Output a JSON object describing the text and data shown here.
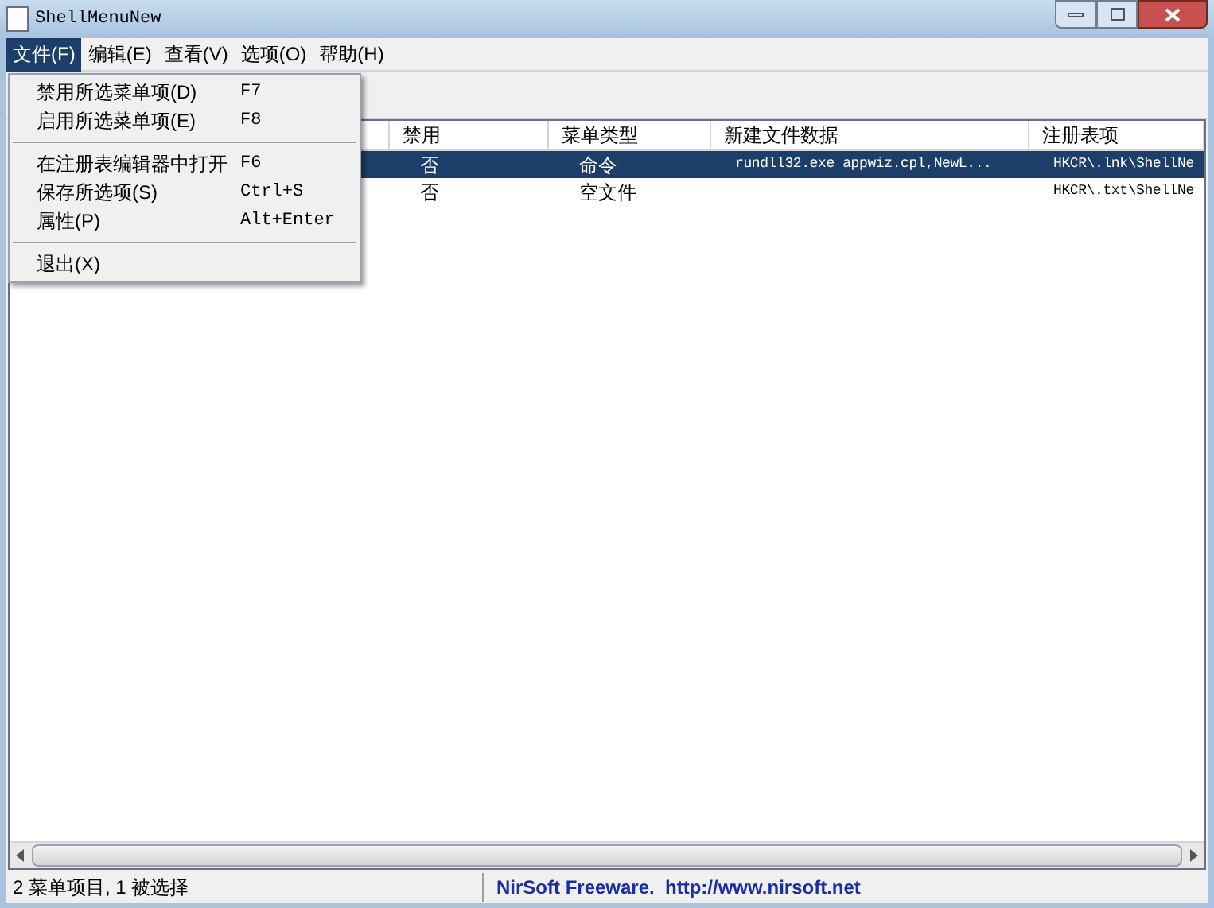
{
  "window": {
    "title": "ShellMenuNew"
  },
  "menu_bar": [
    {
      "label": "文件(F)",
      "selected": true
    },
    {
      "label": "编辑(E)",
      "selected": false
    },
    {
      "label": "查看(V)",
      "selected": false
    },
    {
      "label": "选项(O)",
      "selected": false
    },
    {
      "label": "帮助(H)",
      "selected": false
    }
  ],
  "dropdown": [
    {
      "kind": "item",
      "label": "禁用所选菜单项(D)",
      "shortcut": "F7"
    },
    {
      "kind": "item",
      "label": "启用所选菜单项(E)",
      "shortcut": "F8"
    },
    {
      "kind": "separator"
    },
    {
      "kind": "item",
      "label": "在注册表编辑器中打开",
      "shortcut": "F6"
    },
    {
      "kind": "item",
      "label": "保存所选项(S)",
      "shortcut": "Ctrl+S"
    },
    {
      "kind": "item",
      "label": "属性(P)",
      "shortcut": "Alt+Enter"
    },
    {
      "kind": "separator"
    },
    {
      "kind": "item",
      "label": "退出(X)"
    }
  ],
  "table": {
    "columns": [
      "禁用",
      "菜单类型",
      "新建文件数据",
      "注册表项"
    ],
    "rows": [
      {
        "selected": true,
        "cells": [
          "否",
          "命令",
          "rundll32.exe appwiz.cpl,NewL...",
          "HKCR\\.lnk\\ShellNe"
        ]
      },
      {
        "selected": false,
        "cells": [
          "否",
          "空文件",
          "",
          "HKCR\\.txt\\ShellNe"
        ]
      }
    ]
  },
  "status_bar": {
    "count": "2 菜单项目, 1 被选择",
    "link": "NirSoft Freeware.  http://www.nirsoft.net"
  }
}
